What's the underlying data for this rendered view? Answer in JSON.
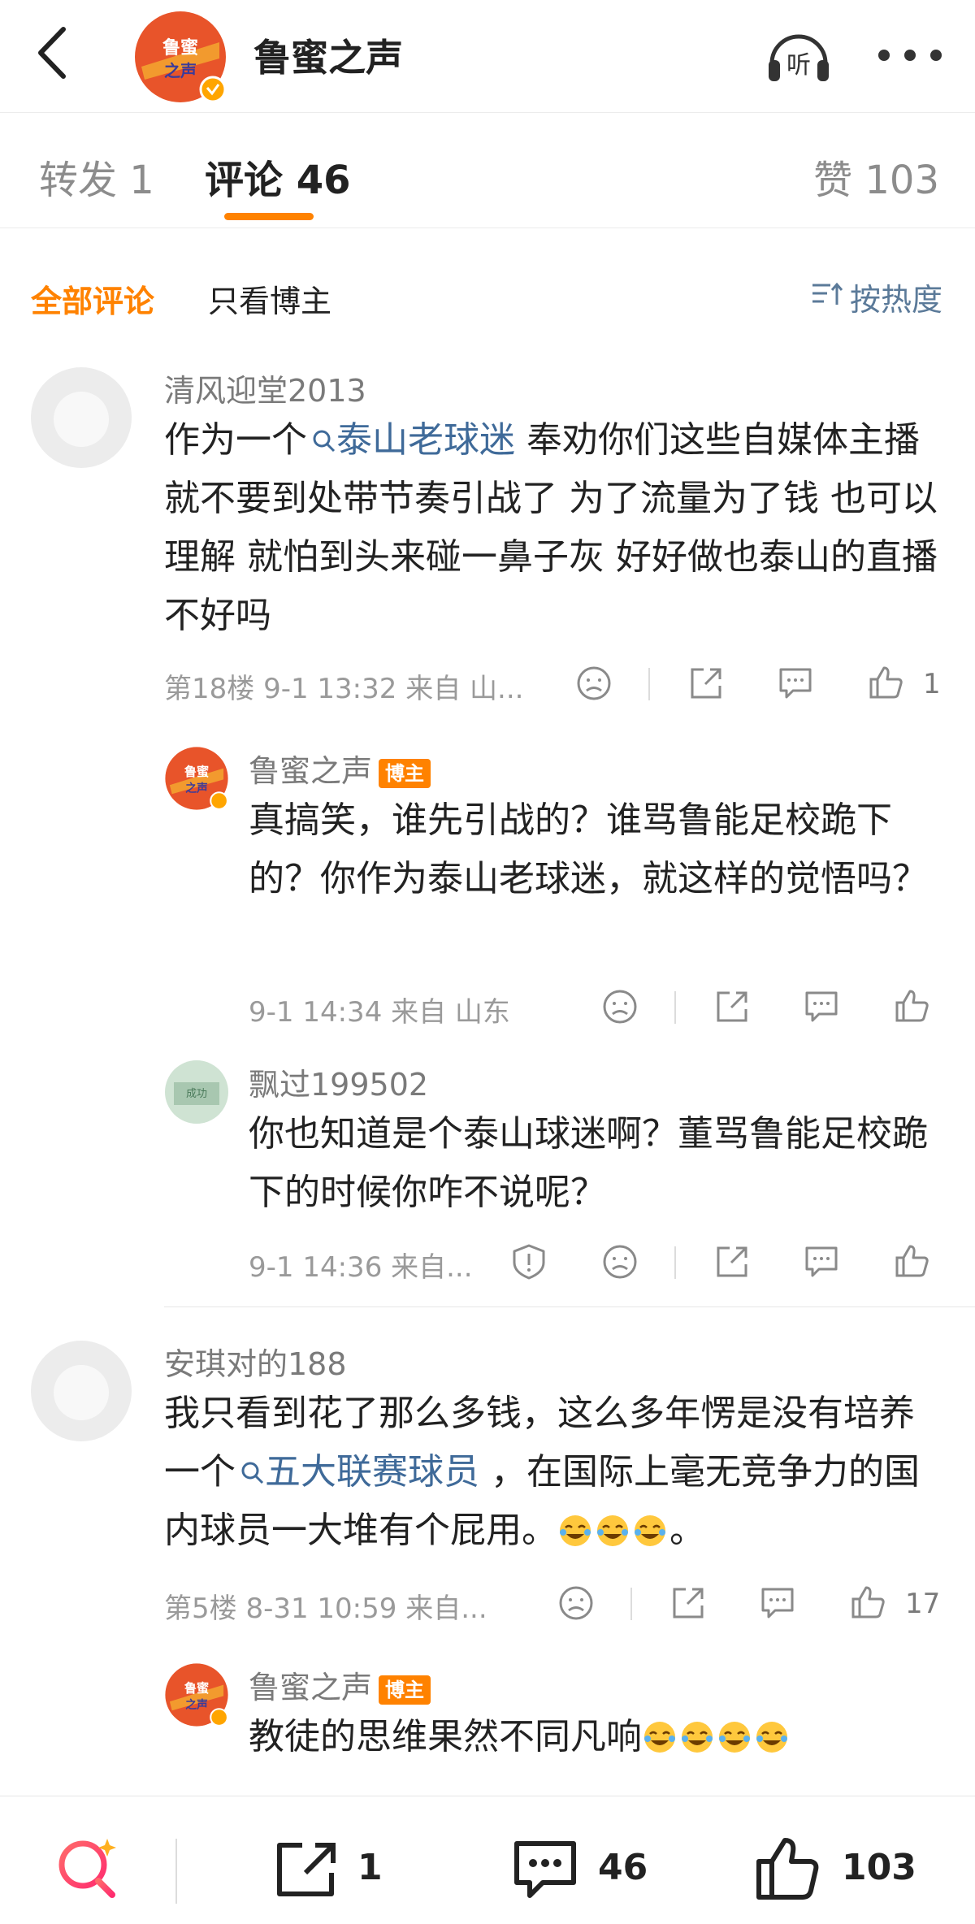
{
  "header": {
    "title": "鲁蜜之声",
    "back_icon": "chevron-left-icon",
    "listen_label": "听",
    "more_icon": "more-dots-icon",
    "avatar_text": "鲁蜜之声"
  },
  "tabs": {
    "repost": "转发 1",
    "comment": "评论 46",
    "like": "赞 103"
  },
  "filter": {
    "all": "全部评论",
    "blogger_only": "只看博主",
    "sort": "按热度"
  },
  "colors": {
    "accent": "#ff8200",
    "topic": "#3f6a99",
    "meta": "#9a9a9a"
  },
  "comments": [
    {
      "username": "清风迎堂2013",
      "body_parts": [
        "作为一个",
        "泰山老球迷",
        " 奉劝你们这些自媒体主播 就不要到处带节奏引战了 为了流量为了钱 也可以理解 就怕到头来碰一鼻子灰 好好做也泰山的直播 不好吗"
      ],
      "meta": "第18楼 9-1 13:32 来自 山...",
      "likes": "1",
      "replies": [
        {
          "username": "鲁蜜之声",
          "badge": "博主",
          "body": "真搞笑，谁先引战的？谁骂鲁能足校跪下的？你作为泰山老球迷，就这样的觉悟吗？",
          "meta": "9-1 14:34 来自 山东"
        },
        {
          "username": "飘过199502",
          "body": "你也知道是个泰山球迷啊？董骂鲁能足校跪下的时候你咋不说呢？",
          "meta": "9-1 14:36 来自..."
        }
      ]
    },
    {
      "username": "安琪对的188",
      "body_parts": [
        "我只看到花了那么多钱，这么多年愣是没有培养一个",
        "五大联赛球员",
        " ，在国际上毫无竞争力的国内球员一大堆有个屁用。",
        "。"
      ],
      "meta": "第5楼 8-31 10:59 来自...",
      "likes": "17",
      "replies": [
        {
          "username": "鲁蜜之声",
          "badge": "博主",
          "body": "教徒的思维果然不同凡响"
        }
      ]
    }
  ],
  "bottom_bar": {
    "repost_count": "1",
    "comment_count": "46",
    "like_count": "103"
  }
}
